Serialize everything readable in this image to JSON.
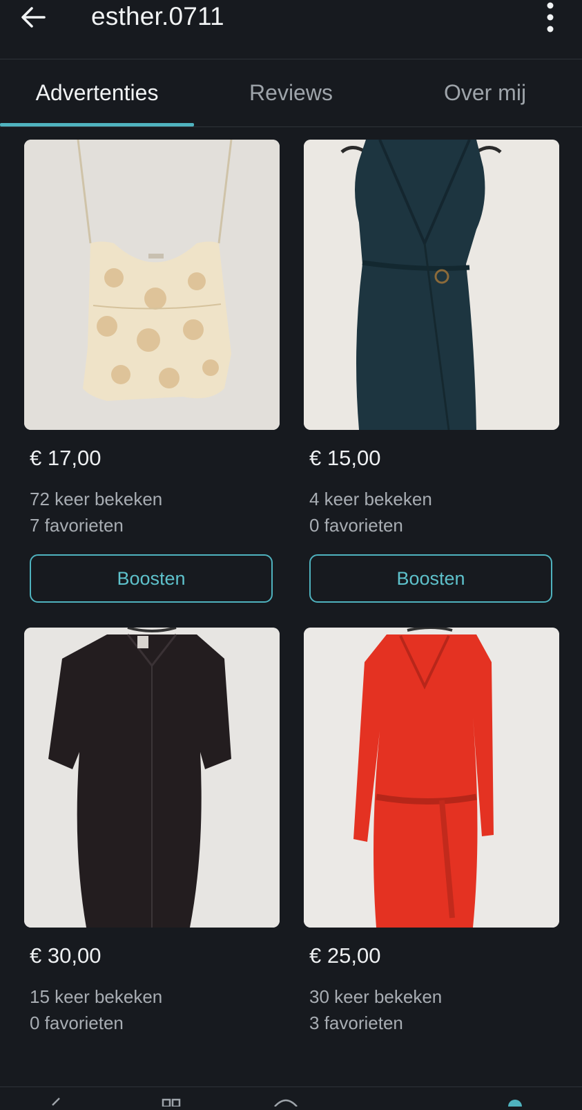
{
  "header": {
    "title": "esther.0711",
    "back_icon": "arrow-left-icon",
    "menu_icon": "more-vertical-icon"
  },
  "tabs": [
    {
      "label": "Advertenties",
      "active": true
    },
    {
      "label": "Reviews",
      "active": false
    },
    {
      "label": "Over mij",
      "active": false
    }
  ],
  "listings": [
    {
      "price": "€ 17,00",
      "views": "72 keer bekeken",
      "favorites": "7 favorieten",
      "boost_label": "Boosten",
      "image": "cream-floral-camisole"
    },
    {
      "price": "€ 15,00",
      "views": "4 keer bekeken",
      "favorites": "0 favorieten",
      "boost_label": "Boosten",
      "image": "dark-teal-wrap-dress"
    },
    {
      "price": "€ 30,00",
      "views": "15 keer bekeken",
      "favorites": "0 favorieten",
      "image": "black-shirt-dress"
    },
    {
      "price": "€ 25,00",
      "views": "30 keer bekeken",
      "favorites": "3 favorieten",
      "image": "red-belted-dress"
    }
  ],
  "colors": {
    "background": "#171a1f",
    "accent": "#4fb3bf",
    "text_primary": "#f1f3f4",
    "text_secondary": "#a8adb3"
  }
}
